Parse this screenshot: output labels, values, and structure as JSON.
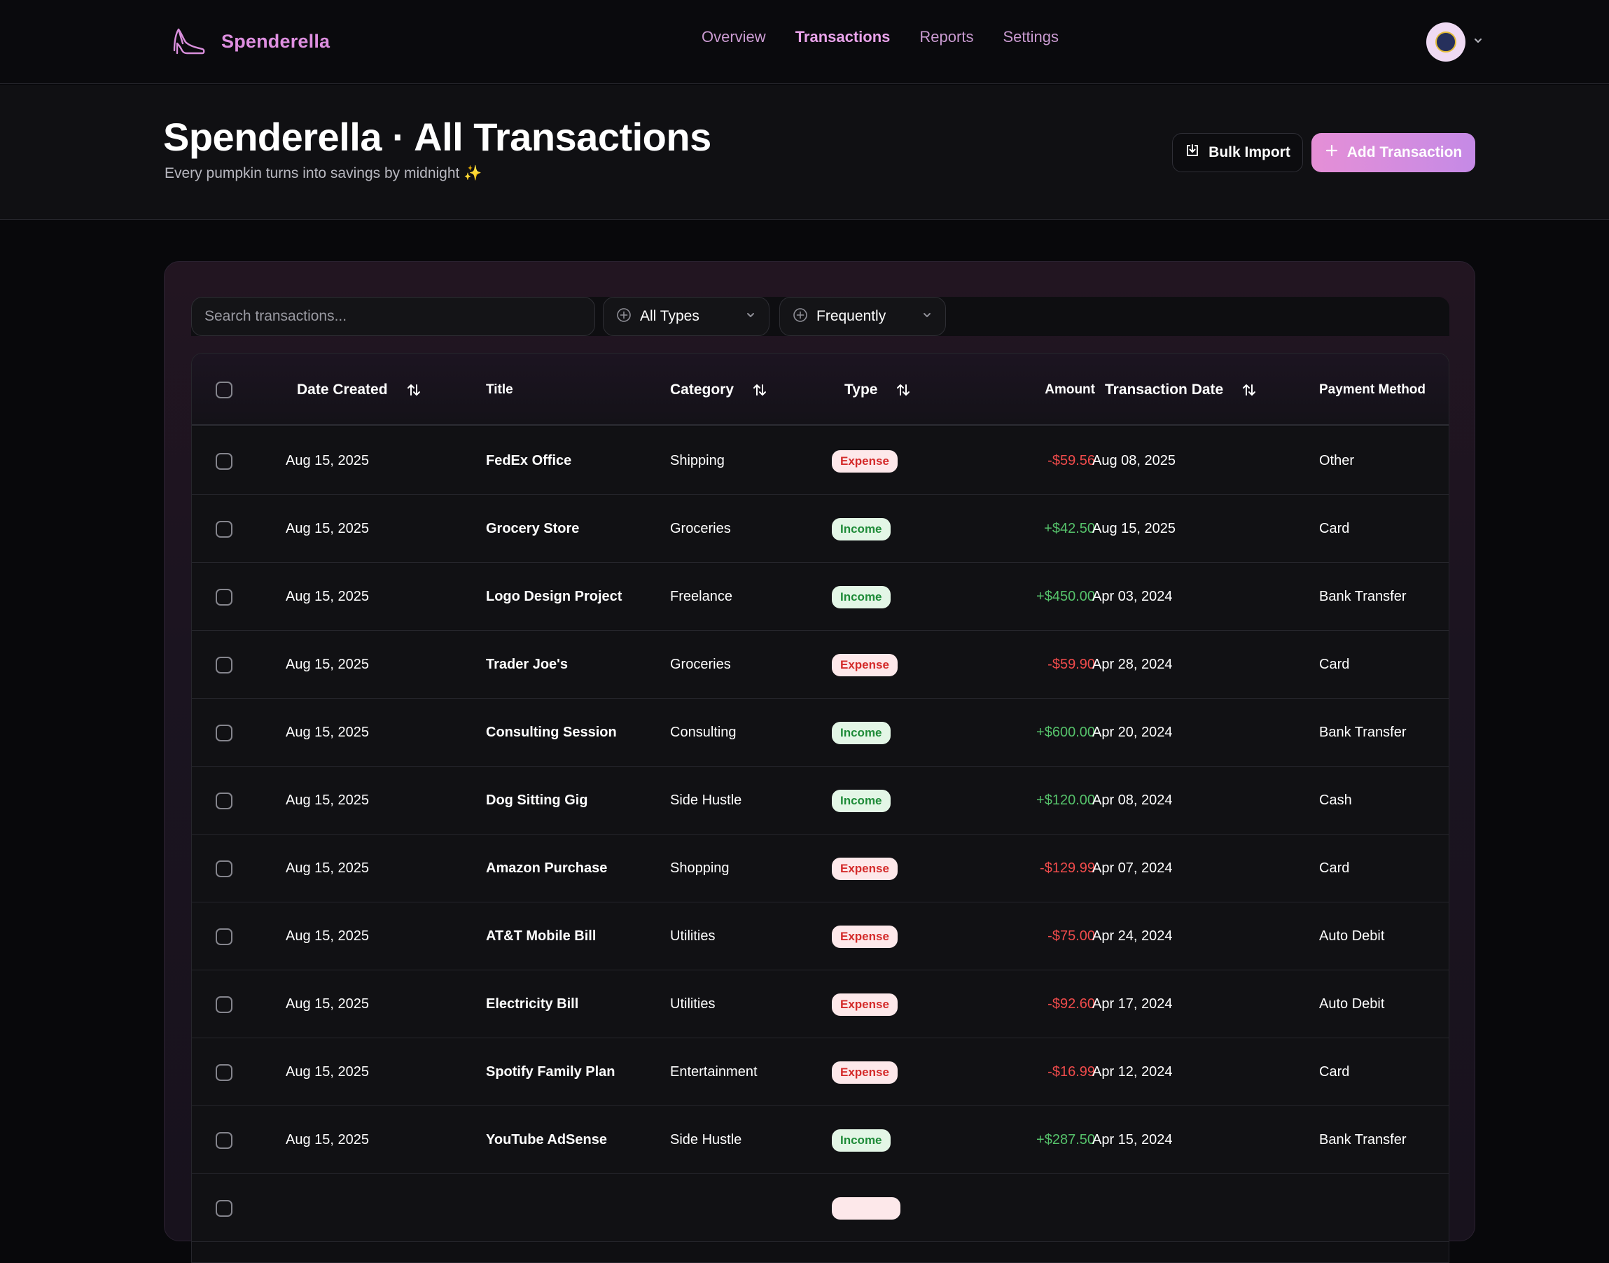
{
  "nav": {
    "brand": "Spenderella",
    "links": [
      "Overview",
      "Transactions",
      "Reports",
      "Settings"
    ],
    "active": "Transactions"
  },
  "header": {
    "title": "Spenderella · All Transactions",
    "subtitle": "Every pumpkin turns into savings by midnight ✨",
    "bulk_import": "Bulk Import",
    "add_transaction": "Add Transaction"
  },
  "toolbar": {
    "search_placeholder": "Search transactions...",
    "type_filter": "All Types",
    "frequency_filter": "Frequently"
  },
  "columns": {
    "date_created": "Date Created",
    "title": "Title",
    "category": "Category",
    "type": "Type",
    "amount": "Amount",
    "transaction_date": "Transaction Date",
    "payment_method": "Payment Method"
  },
  "colors": {
    "accent": "#de8fe0",
    "expense": "#ef4b4b",
    "income": "#55c16a"
  },
  "rows": [
    {
      "date_created": "Aug 15, 2025",
      "title": "FedEx Office",
      "category": "Shipping",
      "type": "Expense",
      "amount": "-$59.56",
      "transaction_date": "Aug 08, 2025",
      "payment_method": "Other"
    },
    {
      "date_created": "Aug 15, 2025",
      "title": "Grocery Store",
      "category": "Groceries",
      "type": "Income",
      "amount": "+$42.50",
      "transaction_date": "Aug 15, 2025",
      "payment_method": "Card"
    },
    {
      "date_created": "Aug 15, 2025",
      "title": "Logo Design Project",
      "category": "Freelance",
      "type": "Income",
      "amount": "+$450.00",
      "transaction_date": "Apr 03, 2024",
      "payment_method": "Bank Transfer"
    },
    {
      "date_created": "Aug 15, 2025",
      "title": "Trader Joe's",
      "category": "Groceries",
      "type": "Expense",
      "amount": "-$59.90",
      "transaction_date": "Apr 28, 2024",
      "payment_method": "Card"
    },
    {
      "date_created": "Aug 15, 2025",
      "title": "Consulting Session",
      "category": "Consulting",
      "type": "Income",
      "amount": "+$600.00",
      "transaction_date": "Apr 20, 2024",
      "payment_method": "Bank Transfer"
    },
    {
      "date_created": "Aug 15, 2025",
      "title": "Dog Sitting Gig",
      "category": "Side Hustle",
      "type": "Income",
      "amount": "+$120.00",
      "transaction_date": "Apr 08, 2024",
      "payment_method": "Cash"
    },
    {
      "date_created": "Aug 15, 2025",
      "title": "Amazon Purchase",
      "category": "Shopping",
      "type": "Expense",
      "amount": "-$129.99",
      "transaction_date": "Apr 07, 2024",
      "payment_method": "Card"
    },
    {
      "date_created": "Aug 15, 2025",
      "title": "AT&T Mobile Bill",
      "category": "Utilities",
      "type": "Expense",
      "amount": "-$75.00",
      "transaction_date": "Apr 24, 2024",
      "payment_method": "Auto Debit"
    },
    {
      "date_created": "Aug 15, 2025",
      "title": "Electricity Bill",
      "category": "Utilities",
      "type": "Expense",
      "amount": "-$92.60",
      "transaction_date": "Apr 17, 2024",
      "payment_method": "Auto Debit"
    },
    {
      "date_created": "Aug 15, 2025",
      "title": "Spotify Family Plan",
      "category": "Entertainment",
      "type": "Expense",
      "amount": "-$16.99",
      "transaction_date": "Apr 12, 2024",
      "payment_method": "Card"
    },
    {
      "date_created": "Aug 15, 2025",
      "title": "YouTube AdSense",
      "category": "Side Hustle",
      "type": "Income",
      "amount": "+$287.50",
      "transaction_date": "Apr 15, 2024",
      "payment_method": "Bank Transfer"
    }
  ]
}
